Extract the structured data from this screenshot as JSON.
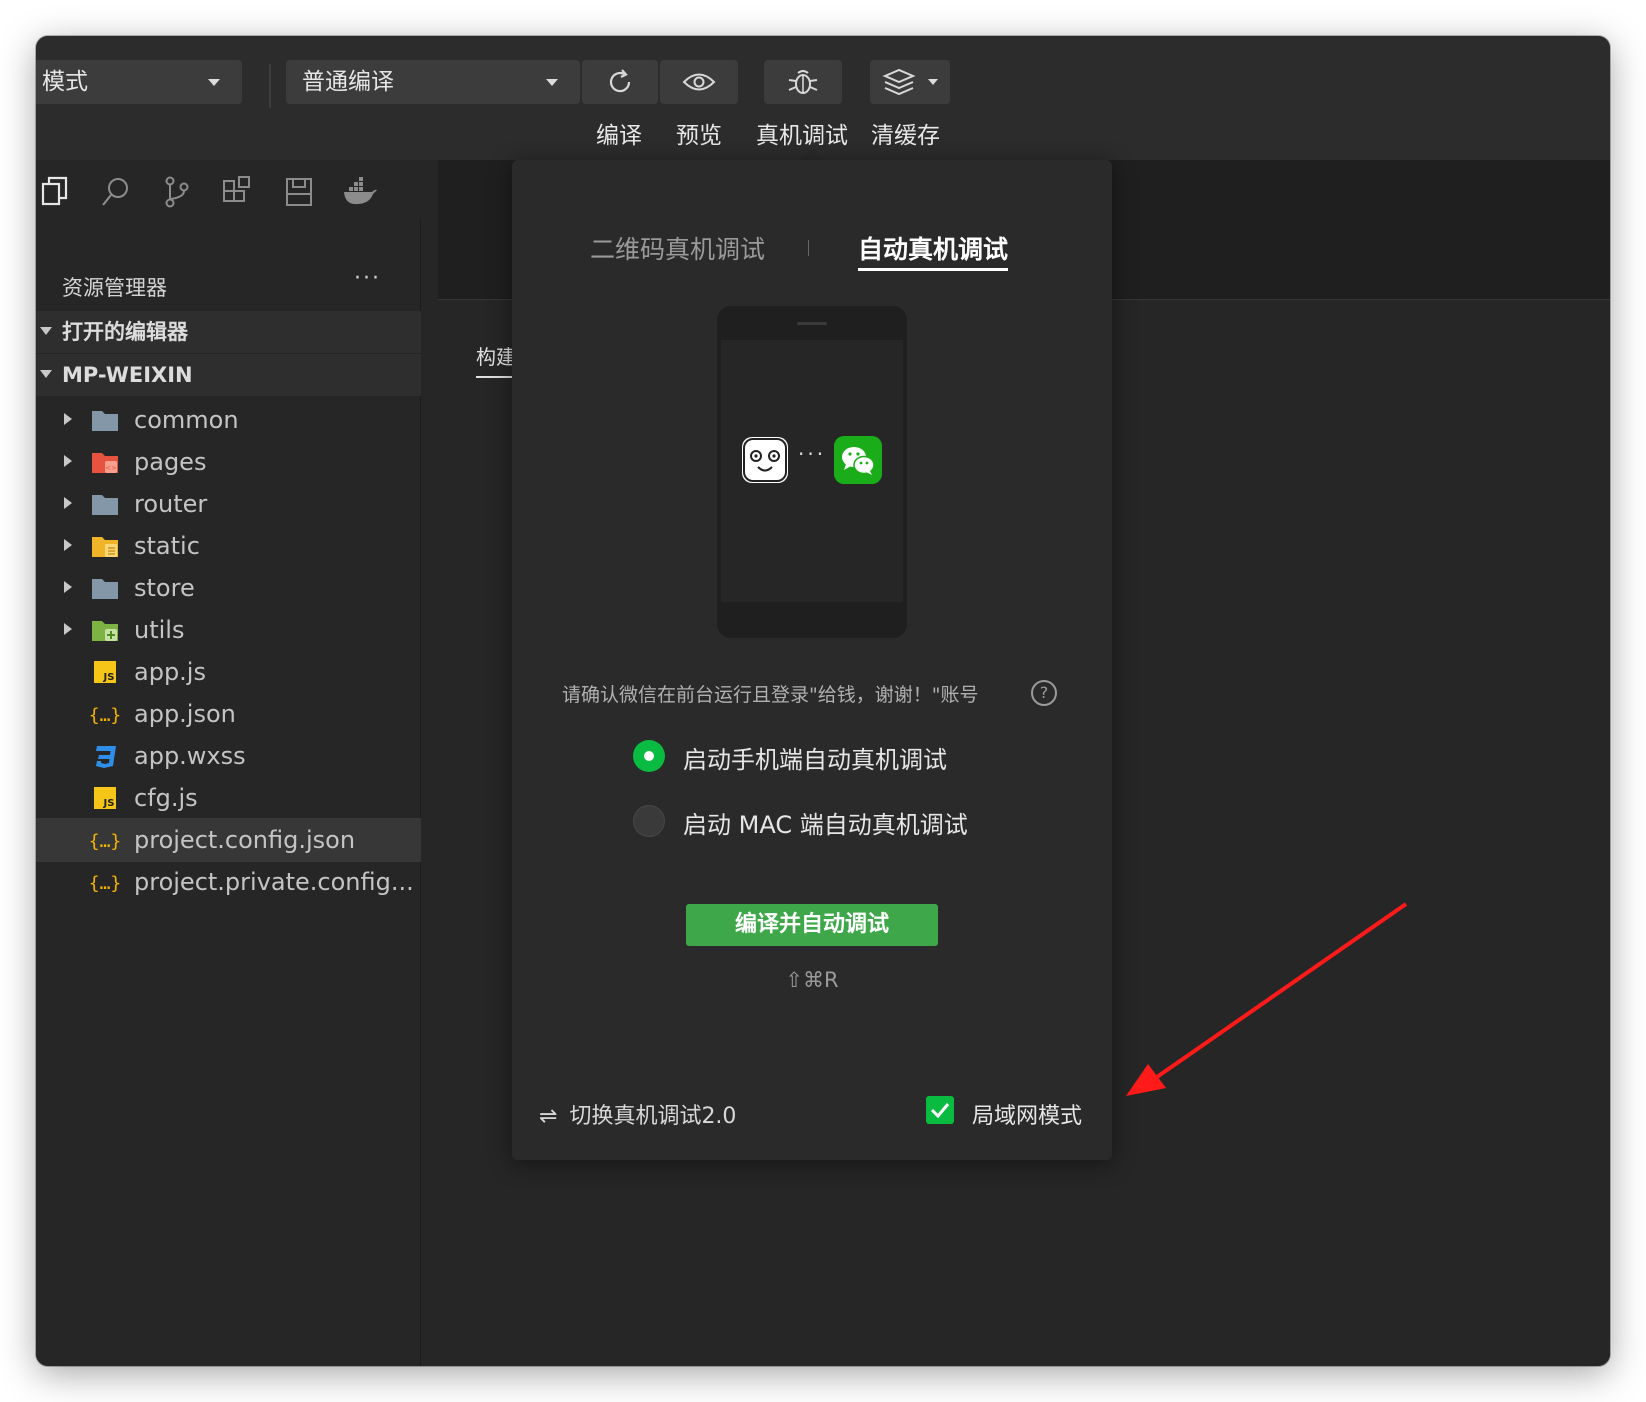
{
  "toolbar": {
    "mode_select": "模式",
    "compile_select": "普通编译",
    "buttons": {
      "compile": "编译",
      "preview": "预览",
      "remote_debug": "真机调试",
      "clear_cache": "清缓存"
    }
  },
  "explorer": {
    "title": "资源管理器",
    "more": "···",
    "open_editors": "打开的编辑器",
    "project": "MP-WEIXIN",
    "items": [
      {
        "name": "common",
        "type": "folder"
      },
      {
        "name": "pages",
        "type": "folder-pages"
      },
      {
        "name": "router",
        "type": "folder"
      },
      {
        "name": "static",
        "type": "folder-static"
      },
      {
        "name": "store",
        "type": "folder"
      },
      {
        "name": "utils",
        "type": "folder-utils"
      },
      {
        "name": "app.js",
        "type": "js"
      },
      {
        "name": "app.json",
        "type": "json"
      },
      {
        "name": "app.wxss",
        "type": "css"
      },
      {
        "name": "cfg.js",
        "type": "js"
      },
      {
        "name": "project.config.json",
        "type": "json",
        "selected": true
      },
      {
        "name": "project.private.config...",
        "type": "json"
      }
    ]
  },
  "editor": {
    "build_tab": "构建"
  },
  "popup": {
    "tabs": [
      {
        "label": "二维码真机调试",
        "active": false
      },
      {
        "label": "自动真机调试",
        "active": true
      }
    ],
    "dots": "···",
    "confirm_text": "请确认微信在前台运行且登录\"给钱，谢谢！\"账号",
    "help": "?",
    "options": [
      {
        "label": "启动手机端自动真机调试",
        "selected": true
      },
      {
        "label": "启动 MAC 端自动真机调试",
        "selected": false
      }
    ],
    "primary_button": "编译并自动调试",
    "shortcut": "⇧⌘R",
    "switch_label": "切换真机调试2.0",
    "switch_icon": "⇌",
    "lan_mode": {
      "label": "局域网模式",
      "checked": true
    }
  },
  "colors": {
    "accent_green": "#09bb40",
    "button_green": "#3ea74a",
    "annotation_arrow": "#ff1a1a"
  }
}
